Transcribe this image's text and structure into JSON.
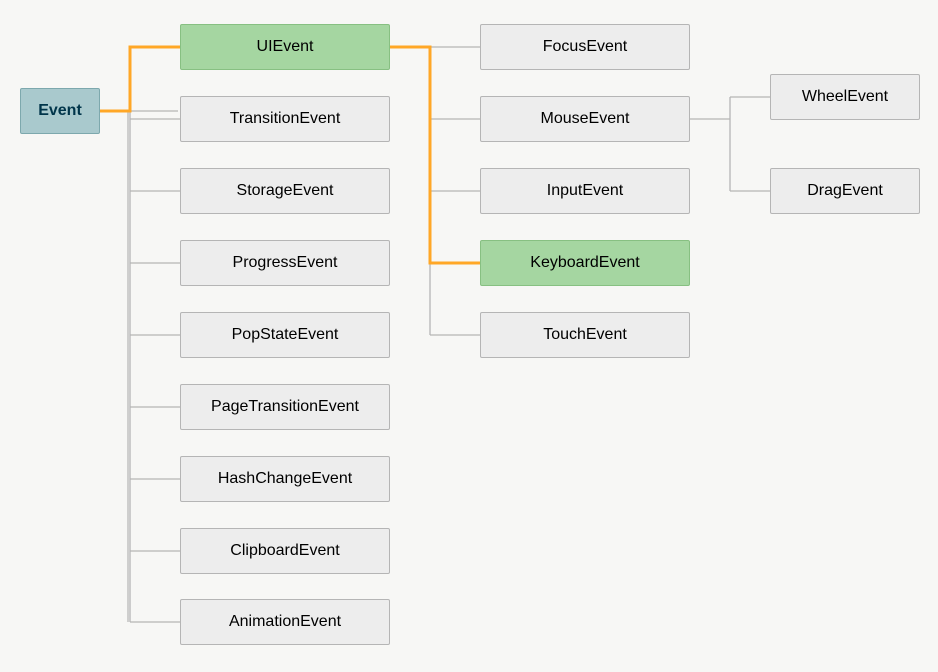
{
  "diagram": {
    "root": "Event",
    "col2": {
      "uievent": "UIEvent",
      "transition": "TransitionEvent",
      "storage": "StorageEvent",
      "progress": "ProgressEvent",
      "popstate": "PopStateEvent",
      "pagetransition": "PageTransitionEvent",
      "hashchange": "HashChangeEvent",
      "clipboard": "ClipboardEvent",
      "animation": "AnimationEvent"
    },
    "col3": {
      "focus": "FocusEvent",
      "mouse": "MouseEvent",
      "input": "InputEvent",
      "keyboard": "KeyboardEvent",
      "touch": "TouchEvent"
    },
    "col4": {
      "wheel": "WheelEvent",
      "drag": "DragEvent"
    },
    "highlight_path": [
      "Event",
      "UIEvent",
      "KeyboardEvent"
    ]
  },
  "colors": {
    "highlight": "#ffa726",
    "line": "#b5b5b5",
    "node_bg": "#ededed",
    "root_bg": "#a9c9cd",
    "green_bg": "#a5d6a1"
  }
}
